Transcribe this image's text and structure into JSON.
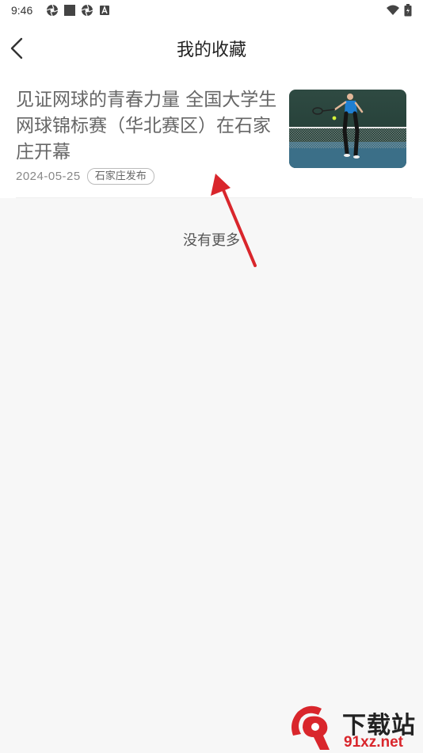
{
  "status_bar": {
    "time": "9:46",
    "left_icons": [
      "shutter-icon",
      "square-icon",
      "shutter-icon",
      "a-icon"
    ],
    "right_icons": [
      "wifi-icon",
      "battery-icon"
    ]
  },
  "header": {
    "title": "我的收藏",
    "back_icon": "chevron-left-icon"
  },
  "favorites": [
    {
      "title": "见证网球的青春力量 全国大学生网球锦标赛（华北赛区）在石家庄开幕",
      "date": "2024-05-25",
      "tag": "石家庄发布",
      "thumbnail": "tennis-player-photo"
    }
  ],
  "footer_text": "没有更多",
  "watermark": {
    "line1": "下载站",
    "line2": "91xz.net"
  },
  "colors": {
    "background": "#f7f7f7",
    "card": "#ffffff",
    "title_text": "#666666",
    "annotation_arrow": "#d9262c",
    "watermark_red": "#d9262c"
  }
}
